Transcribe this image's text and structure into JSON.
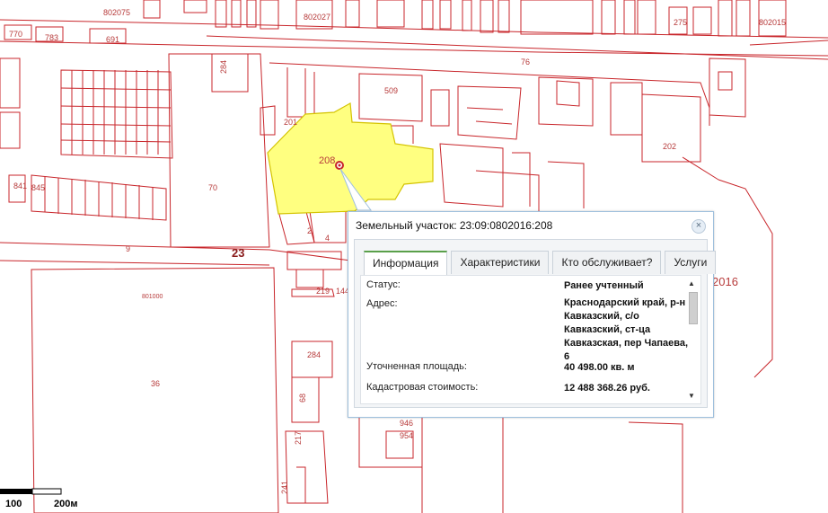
{
  "map": {
    "parcel_labels": [
      "23",
      "802075",
      "802027",
      "802015",
      "770",
      "783",
      "691",
      "284",
      "76",
      "509",
      "201",
      "208",
      "70",
      "2",
      "4",
      "9",
      "801000",
      "36",
      "219",
      "217",
      "144",
      "284",
      "68",
      "202",
      "2016",
      "946",
      "954",
      "841",
      "845",
      "275",
      "241"
    ],
    "selected_parcel": "208"
  },
  "scale": {
    "label_100": "100",
    "label_200": "200м"
  },
  "popup": {
    "title": "Земельный участок: 23:09:0802016:208",
    "close_label": "×",
    "tabs": [
      "Информация",
      "Характеристики",
      "Кто обслуживает?",
      "Услуги"
    ],
    "active_tab": "Информация",
    "rows": [
      {
        "label": "Статус:",
        "value": "Ранее учтенный"
      },
      {
        "label": "Адрес:",
        "value": "Краснодарский край, р-н Кавказский, с/о Кавказский, ст-ца Кавказская, пер Чапаева, 6"
      },
      {
        "label": "Уточненная площадь:",
        "value": "40 498.00 кв. м"
      },
      {
        "label": "Кадастровая стоимость:",
        "value": "12 488 368.26 руб."
      }
    ]
  },
  "colors": {
    "parcel_line": "#c8262b",
    "selected_fill": "#ffff80",
    "accent_tab": "#5aa04a"
  }
}
